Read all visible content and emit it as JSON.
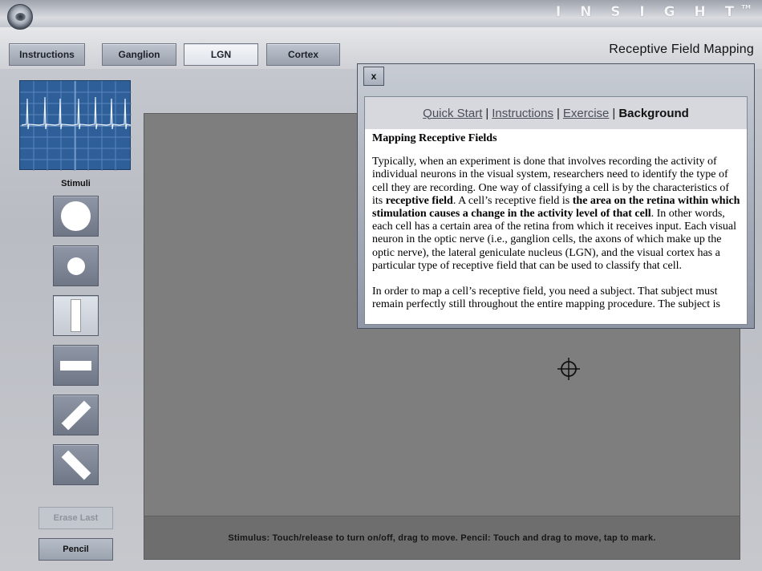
{
  "header": {
    "brand": "I N S I G H T",
    "trademark": "TM",
    "app_title": "Receptive Field Mapping"
  },
  "tabs": [
    {
      "label": "Instructions",
      "active": false
    },
    {
      "label": "Ganglion",
      "active": false
    },
    {
      "label": "LGN",
      "active": true
    },
    {
      "label": "Cortex",
      "active": false
    }
  ],
  "sidebar": {
    "stimuli_label": "Stimuli",
    "stimuli": [
      "large-circle",
      "small-circle",
      "vertical-bar",
      "horizontal-bar",
      "diagonal-bar-right",
      "diagonal-bar-left"
    ],
    "selected_stimulus": "vertical-bar",
    "erase_last_label": "Erase Last",
    "pencil_label": "Pencil"
  },
  "stage": {
    "footer_text": "Stimulus: Touch/release to turn on/off, drag to move.   Pencil: Touch and drag to move, tap to mark."
  },
  "popup": {
    "close_label": "x",
    "nav": {
      "quick_start": "Quick Start",
      "instructions": "Instructions",
      "exercise": "Exercise",
      "background": "Background",
      "separator": "|"
    },
    "heading": "Mapping Receptive Fields",
    "p1_a": "Typically, when an experiment is done that involves recording the activity of individual neurons in the visual system, researchers need to identify the type of cell they are recording. One way of classifying a cell is by the characteristics of its ",
    "p1_b": "receptive field",
    "p1_c": ". A cell’s receptive field is ",
    "p1_d": "the area on the retina within which stimulation causes a change in the activity level of that cell",
    "p1_e": ". In other words, each cell has a certain area of the retina from which it receives input. Each visual neuron in the optic nerve (i.e., ganglion cells, the axons of which make up the optic nerve), the lateral geniculate nucleus (LGN), and the visual cortex has a particular type of receptive field that can be used to classify that cell.",
    "p2": "In order to map a cell’s receptive field, you need a subject. That subject must remain perfectly still throughout the entire mapping procedure. The subject is"
  },
  "colors": {
    "oscilloscope_bg": "#2e5f98",
    "stage_bg": "#7e7e7e"
  }
}
